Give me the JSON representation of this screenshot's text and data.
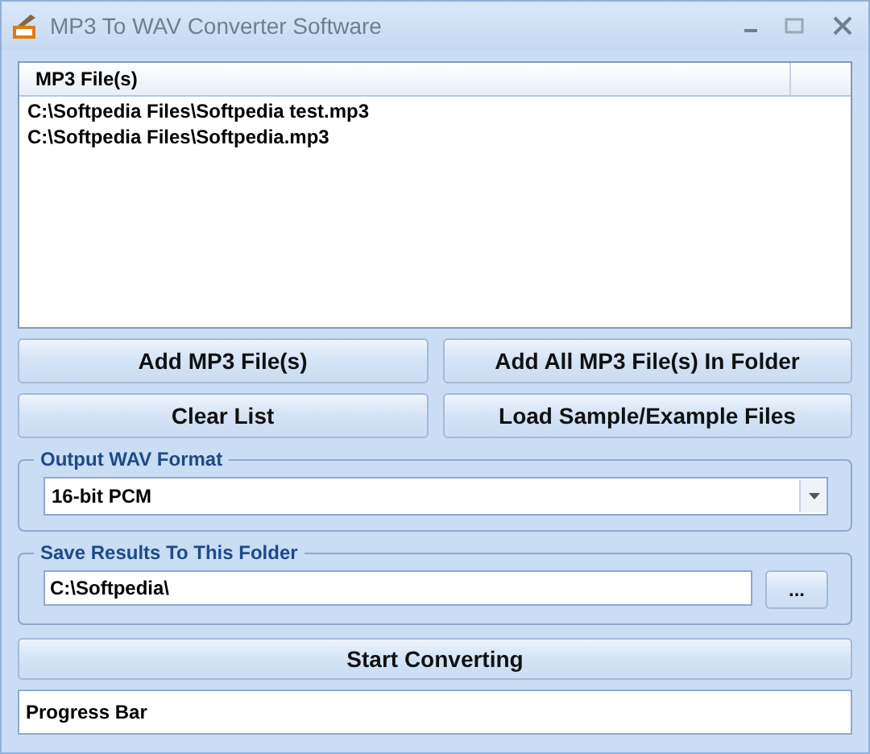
{
  "window": {
    "title": "MP3 To WAV Converter Software"
  },
  "file_list": {
    "columns": [
      "MP3 File(s)"
    ],
    "rows": [
      "C:\\Softpedia Files\\Softpedia test.mp3",
      "C:\\Softpedia Files\\Softpedia.mp3"
    ]
  },
  "buttons": [
    "Add MP3 File(s)",
    "Add All MP3 File(s) In Folder",
    "Clear List",
    "Load Sample/Example Files"
  ],
  "output_format": {
    "label": "Output WAV Format",
    "value": "16-bit PCM"
  },
  "save_folder": {
    "label": "Save Results To This Folder",
    "value": "C:\\Softpedia\\",
    "browse": "..."
  },
  "start_button": "Start Converting",
  "progress": {
    "text": "Progress Bar",
    "level": 0
  }
}
